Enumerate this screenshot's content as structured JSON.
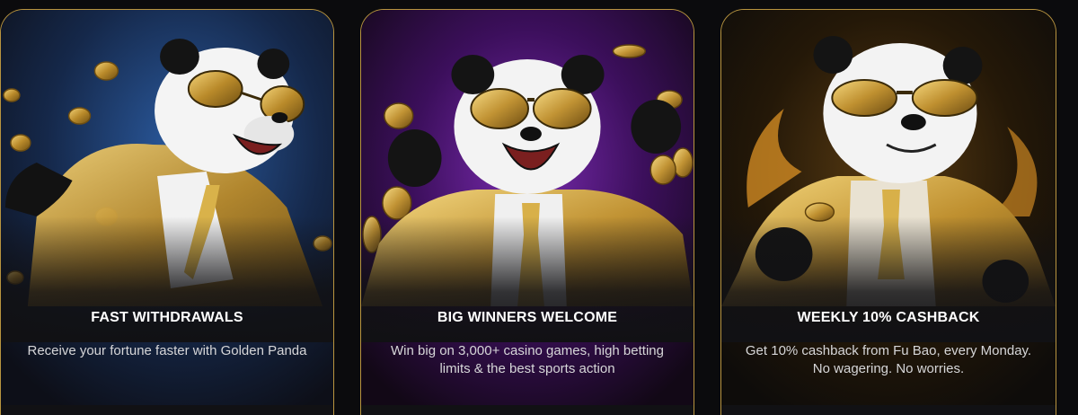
{
  "cards": [
    {
      "title": "FAST WITHDRAWALS",
      "description": "Receive your fortune faster with Golden Panda",
      "background_color": "#1d3a66"
    },
    {
      "title": "BIG WINNERS WELCOME",
      "description": "Win big on 3,000+ casino games, high betting limits & the best sports action",
      "background_color": "#4a1470"
    },
    {
      "title": "WEEKLY 10% CASHBACK",
      "description": "Get 10% cashback from Fu Bao, every Monday. No wagering. No worries.",
      "background_color": "#2a1c08"
    }
  ],
  "colors": {
    "gold": "#c9a03d",
    "card_border": "#b8943f",
    "page_background": "#0b0b0d"
  }
}
